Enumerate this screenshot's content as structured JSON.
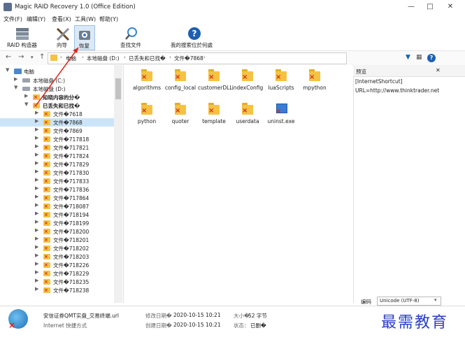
{
  "window": {
    "title": "Magic RAID Recovery 1.0 (Office Edition)"
  },
  "menu": [
    "文件(F)",
    "编辑(Y)",
    "查看(X)",
    "工具(W)",
    "帮助(Y)"
  ],
  "toolbar": {
    "raid_builder": "RAID 构造器",
    "wizard": "向导",
    "recover": "恢复",
    "find_file": "查找文件",
    "my_search": "我的搜索位於何處"
  },
  "address": {
    "crumbs": [
      "电脑",
      "本地磁盘 (D:)",
      "已丢失和已找�",
      "文件�7868"
    ]
  },
  "tree": {
    "root": "电脑",
    "drive_c": "本地磁盘 (C:)",
    "drive_d": "本地磁盘 (D:)",
    "known": "知晓内容的分�",
    "lost": "已丢失和已找�",
    "files": [
      "文件�7618",
      "文件�7868",
      "文件�7869",
      "文件�717818",
      "文件�717821",
      "文件�717824",
      "文件�717829",
      "文件�717830",
      "文件�717833",
      "文件�717836",
      "文件�717864",
      "文件�718087",
      "文件�718194",
      "文件�718199",
      "文件�718200",
      "文件�718201",
      "文件�718202",
      "文件�718203",
      "文件�718226",
      "文件�718229",
      "文件�718235",
      "文件�718238"
    ]
  },
  "files": [
    "algorithms",
    "config_local",
    "customerDLL",
    "indexConfig",
    "luaScripts",
    "mpython",
    "python",
    "quoter",
    "template",
    "userdata",
    "uninst.exe"
  ],
  "preview": {
    "title": "预览",
    "line1": "[InternetShortcut]",
    "line2": "URL=http://www.thinktrader.net",
    "encoding_label": "编码",
    "encoding_value": "Unicode (UTF-8)"
  },
  "status": {
    "filename": "安信证券QMT实盘_交易终端.url",
    "filetype": "Internet 快捷方式",
    "modified_label": "修改日期�",
    "modified_value": "2020-10-15 10:21",
    "created_label": "创建日期�",
    "created_value": "2020-10-15 10:21",
    "size_label": "大小�",
    "size_value": "52 字节",
    "state_label": "状态：",
    "state_value": "已删�"
  },
  "watermark": "最需教育"
}
